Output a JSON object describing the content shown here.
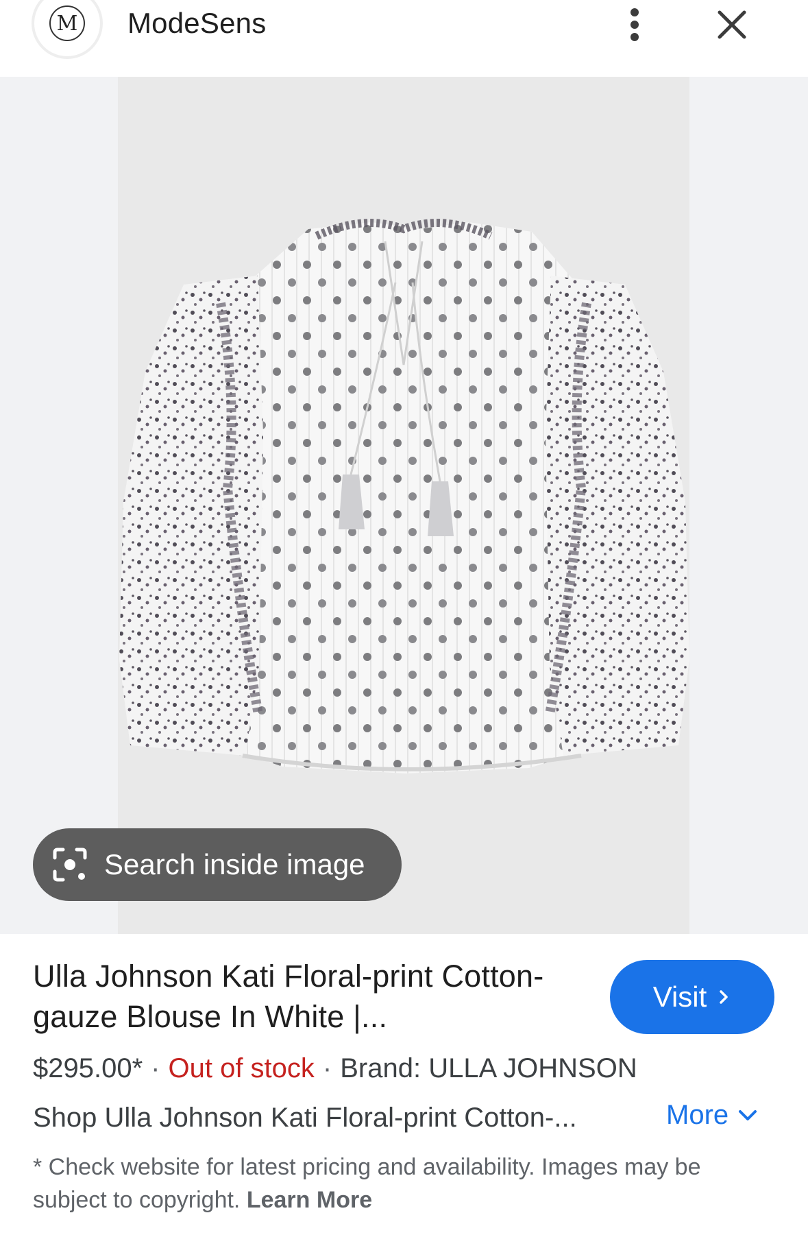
{
  "header": {
    "logo_letter": "M",
    "site_name": "ModeSens",
    "menu_icon": "more-vert-icon",
    "close_icon": "close-icon"
  },
  "image": {
    "description_icon": "blouse-image",
    "lens_button_label": "Search inside image",
    "lens_icon": "google-lens-icon"
  },
  "product": {
    "title": "Ulla Johnson Kati Floral-print Cotton-gauze Blouse In White |...",
    "visit_label": "Visit",
    "price": "$295.00*",
    "stock_status": "Out of stock",
    "brand": "Brand: ULLA JOHNSON",
    "description": "Shop Ulla Johnson Kati Floral-print Cotton-...",
    "more_label": "More",
    "disclaimer": "* Check website for latest pricing and availability. Images may be subject to copyright.",
    "learn_more_label": "Learn More"
  },
  "colors": {
    "accent": "#1a73e8",
    "out_of_stock": "#c5221f",
    "lens_pill": "#5d5d5d"
  }
}
